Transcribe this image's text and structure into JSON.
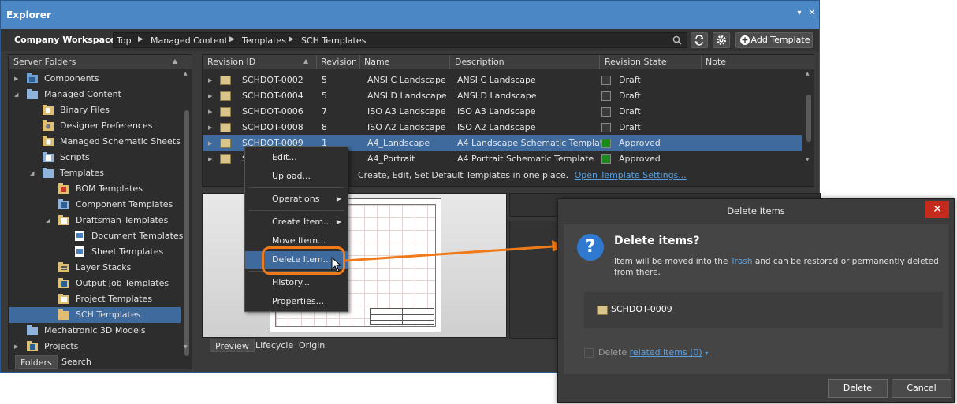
{
  "explorer": {
    "title": "Explorer",
    "title_controls": [
      "▾",
      "✕"
    ],
    "workspace": "Company Workspace",
    "breadcrumb": [
      "Top",
      "Managed Content",
      "Templates",
      "SCH Templates"
    ],
    "add_template": "Add Template"
  },
  "folders": {
    "header": "Server Folders",
    "items": [
      {
        "label": "Components"
      },
      {
        "label": "Managed Content"
      },
      {
        "label": "Binary Files"
      },
      {
        "label": "Designer Preferences"
      },
      {
        "label": "Managed Schematic Sheets"
      },
      {
        "label": "Scripts"
      },
      {
        "label": "Templates"
      },
      {
        "label": "BOM Templates"
      },
      {
        "label": "Component Templates"
      },
      {
        "label": "Draftsman Templates"
      },
      {
        "label": "Document Templates"
      },
      {
        "label": "Sheet Templates"
      },
      {
        "label": "Layer Stacks"
      },
      {
        "label": "Output Job Templates"
      },
      {
        "label": "Project Templates"
      },
      {
        "label": "SCH Templates"
      },
      {
        "label": "Mechatronic 3D Models"
      },
      {
        "label": "Projects"
      }
    ],
    "tabs": [
      "Folders",
      "Search"
    ]
  },
  "list": {
    "columns": [
      "Revision ID",
      "Revision",
      "Name",
      "Description",
      "Revision State",
      "Note"
    ],
    "rows": [
      {
        "id": "SCHDOT-0002",
        "rev": "5",
        "name": "ANSI C Landscape",
        "desc": "ANSI C Landscape",
        "state": "Draft",
        "state_color": "#3a3a3a"
      },
      {
        "id": "SCHDOT-0004",
        "rev": "5",
        "name": "ANSI D Landscape",
        "desc": "ANSI D Landscape",
        "state": "Draft",
        "state_color": "#3a3a3a"
      },
      {
        "id": "SCHDOT-0006",
        "rev": "7",
        "name": "ISO A3 Landscape",
        "desc": "ISO A3 Landscape",
        "state": "Draft",
        "state_color": "#3a3a3a"
      },
      {
        "id": "SCHDOT-0008",
        "rev": "8",
        "name": "ISO A2 Landscape",
        "desc": "ISO A2 Landscape",
        "state": "Draft",
        "state_color": "#3a3a3a"
      },
      {
        "id": "SCHDOT-0009",
        "rev": "1",
        "name": "A4_Landscape",
        "desc": "A4 Landscape Schematic Template",
        "state": "Approved",
        "state_color": "#1a8a1a"
      },
      {
        "id": "S",
        "rev": "",
        "name": "A4_Portrait",
        "desc": "A4 Portrait Schematic Template",
        "state": "Approved",
        "state_color": "#1a8a1a"
      }
    ],
    "info_text": "Create, Edit, Set Default Templates in one place.",
    "info_link": "Open Template Settings..."
  },
  "preview_tabs": [
    "Preview",
    "Lifecycle",
    "Origin"
  ],
  "context_menu": {
    "items": [
      "Edit...",
      "Upload...",
      "Operations",
      "Create Item...",
      "Move Item...",
      "Delete Item...",
      "History...",
      "Properties..."
    ]
  },
  "dialog": {
    "title": "Delete Items",
    "close": "✕",
    "heading": "Delete items?",
    "text_before": "Item will be moved into the",
    "trash_link": "Trash",
    "text_after": "and can be restored or permanently deleted from there.",
    "item": "SCHDOT-0009",
    "related_prefix": "Delete",
    "related_link": "related items (0)",
    "delete_button": "Delete",
    "cancel_button": "Cancel"
  },
  "colors": {
    "accent": "#4a87c4",
    "selection": "#3e6a9e",
    "highlight": "#f07a1a",
    "link": "#5aa0e0"
  }
}
